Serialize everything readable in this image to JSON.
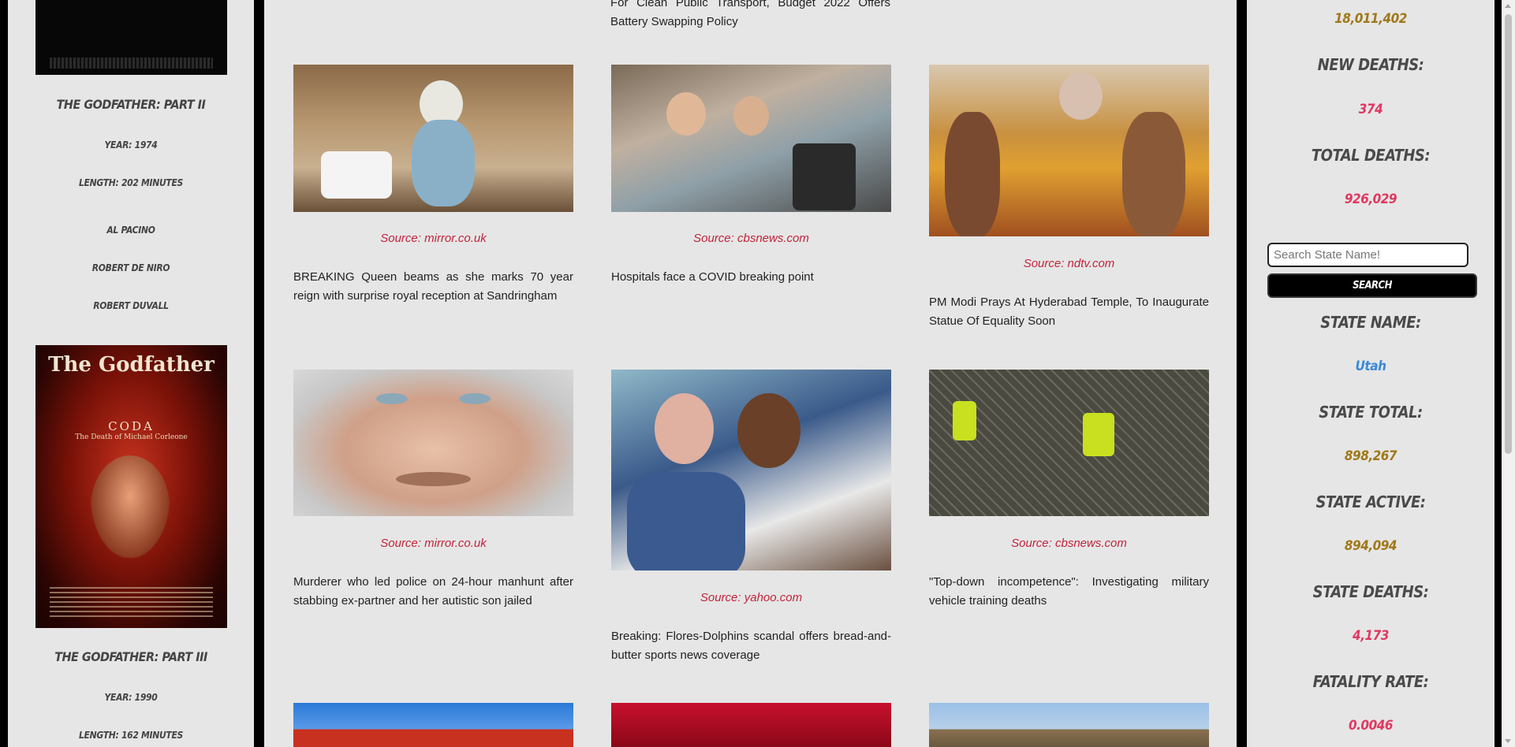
{
  "movies": {
    "top_title": "The Godfather: Part II",
    "top_year": "Year: 1974",
    "top_length": "Length: 202 Minutes",
    "cast": [
      "Al Pacino",
      "Robert De Niro",
      "Robert Duvall"
    ],
    "poster_title": "The Godfather",
    "poster_coda": "CODA",
    "poster_subtitle": "The Death of Michael Corleone",
    "bottom_title": "The Godfather: Part III",
    "bottom_year": "Year: 1990",
    "bottom_length": "Length: 162 Minutes"
  },
  "news": {
    "top_fragment": "For Clean Public Transport, Budget 2022 Offers Battery Swapping Policy",
    "items": [
      {
        "source": "Source: mirror.co.uk",
        "headline": "BREAKING Queen beams as she marks 70 year reign with surprise royal reception at Sandringham"
      },
      {
        "source": "Source: cbsnews.com",
        "headline": "Hospitals face a COVID breaking point"
      },
      {
        "source": "Source: ndtv.com",
        "headline": "PM Modi Prays At Hyderabad Temple, To Inaugurate Statue Of Equality Soon"
      },
      {
        "source": "Source: mirror.co.uk",
        "headline": "Murderer who led police on 24-hour manhunt after stabbing ex-partner and her autistic son jailed"
      },
      {
        "source": "Source: yahoo.com",
        "headline": "Breaking: Flores-Dolphins scandal offers bread-and-butter sports news coverage"
      },
      {
        "source": "Source: cbsnews.com",
        "headline": "\"Top-down incompetence\": Investigating military vehicle training deaths"
      }
    ]
  },
  "stats": {
    "active_value": "18,011,402",
    "new_deaths_label": "New Deaths:",
    "new_deaths_value": "374",
    "total_deaths_label": "Total Deaths:",
    "total_deaths_value": "926,029",
    "search_placeholder": "Search State Name!",
    "search_button": "Search",
    "state_name_label": "State Name:",
    "state_name_value": "Utah",
    "state_total_label": "State Total:",
    "state_total_value": "898,267",
    "state_active_label": "State Active:",
    "state_active_value": "894,094",
    "state_deaths_label": "State Deaths:",
    "state_deaths_value": "4,173",
    "fatality_rate_label": "Fatality Rate:",
    "fatality_rate_value": "0.0046"
  },
  "colors": {
    "source_red": "#c0243c",
    "value_gold": "#a07818",
    "value_red": "#e03860",
    "value_blue": "#3a8ad8"
  }
}
